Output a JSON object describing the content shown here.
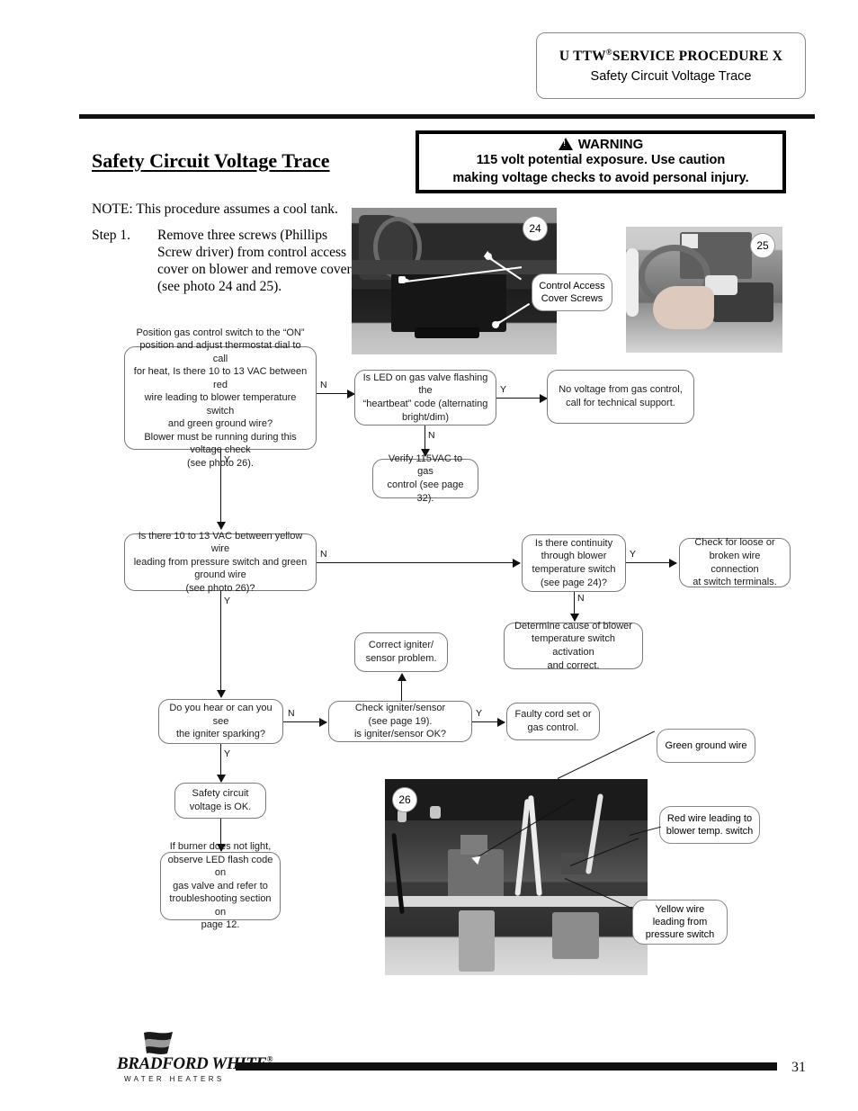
{
  "header": {
    "title_prefix": "U TTW",
    "title_reg": "®",
    "title_suffix": "SERVICE PROCEDURE  X",
    "subtitle": "Safety Circuit Voltage Trace"
  },
  "page_title": "Safety Circuit Voltage Trace",
  "warning": {
    "heading": "WARNING",
    "line1": "115 volt potential exposure. Use caution",
    "line2": "making voltage checks to avoid personal injury."
  },
  "note": "NOTE: This procedure assumes a cool tank.",
  "step": {
    "label": "Step 1.",
    "body": "Remove three screws (Phillips Screw driver) from control access cover on blower and remove cover (see photo 24 and 25)."
  },
  "photos": {
    "p24_badge": "24",
    "p25_badge": "25",
    "p26_badge": "26"
  },
  "callouts": {
    "control_access": "Control Access\nCover Screws",
    "green_ground": "Green ground wire",
    "red_wire": "Red wire leading to\nblower temp. switch",
    "yellow_wire": "Yellow wire\nleading from\npressure switch"
  },
  "flow": {
    "b1": "Position gas control switch to the “ON”\nposition and adjust thermostat dial to call\nfor heat, Is there 10 to 13 VAC  between red\nwire leading to blower temperature switch\nand green ground wire?\nBlower must be running during this\nvoltage check\n(see photo 26).",
    "b2": "Is LED on gas valve flashing the\n“heartbeat” code (alternating\nbright/dim)",
    "b3": "No voltage from gas control,\ncall for technical support.",
    "b4": "Verify 115VAC to gas\ncontrol (see page 32).",
    "b5": "Is there 10 to 13 VAC  between yellow wire\nleading from pressure switch and green\nground wire\n(see photo 26)?",
    "b6": "Is there continuity\nthrough blower\ntemperature switch\n(see page 24)?",
    "b7": "Check for loose or\nbroken wire connection\nat switch terminals.",
    "b8": "Determine cause of blower\ntemperature switch activation\nand correct.",
    "b9": "Correct igniter/\nsensor problem.",
    "b10": "Do you hear or can you see\nthe igniter sparking?",
    "b11": "Check igniter/sensor\n(see page 19).\nis igniter/sensor OK?",
    "b12": "Faulty cord set or\ngas control.",
    "b13": "Safety circuit\nvoltage is OK.",
    "b14": "If burner does not light,\nobserve LED flash code on\ngas valve and refer to\ntroubleshooting section on\npage 12."
  },
  "edge_labels": {
    "b1_n": "N",
    "b1_y": "Y",
    "b2_y": "Y",
    "b2_n": "N",
    "b5_n": "N",
    "b5_y": "Y",
    "b6_y": "Y",
    "b6_n": "N",
    "b10_n": "N",
    "b10_y": "Y",
    "b11_y": "Y"
  },
  "footer": {
    "brand": "BRADFORD WHITE",
    "brand_reg": "®",
    "tagline": "WATER HEATERS",
    "page_number": "31"
  }
}
